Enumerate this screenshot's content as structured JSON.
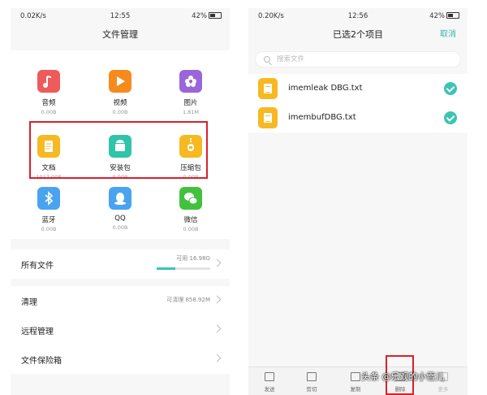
{
  "left": {
    "status": {
      "speed": "0.02K/s",
      "time": "12:55",
      "battery": "42%"
    },
    "title": "文件管理",
    "categories": [
      {
        "name": "音频",
        "size": "0.00B",
        "icon": "music-icon",
        "color": "#ef5a5a"
      },
      {
        "name": "视频",
        "size": "0.00B",
        "icon": "play-icon",
        "color": "#f78a1d"
      },
      {
        "name": "图片",
        "size": "1.81M",
        "icon": "flower-icon",
        "color": "#9a66d9"
      },
      {
        "name": "文档",
        "size": "1017.00B",
        "icon": "document-icon",
        "color": "#f6b922"
      },
      {
        "name": "安装包",
        "size": "0.00B",
        "icon": "android-icon",
        "color": "#2fc4a8"
      },
      {
        "name": "压缩包",
        "size": "0.00B",
        "icon": "zip-icon",
        "color": "#f6b922"
      },
      {
        "name": "蓝牙",
        "size": "0.00B",
        "icon": "bluetooth-icon",
        "color": "#4aa3ef"
      },
      {
        "name": "QQ",
        "size": "0.00B",
        "icon": "qq-icon",
        "color": "#4aa3ef"
      },
      {
        "name": "微信",
        "size": "0.00B",
        "icon": "wechat-icon",
        "color": "#42c13e"
      }
    ],
    "all_files": {
      "label": "所有文件",
      "available": "可用 16.98G",
      "used_fraction": 0.35
    },
    "rows": [
      {
        "label": "清理",
        "value": "可清理 858.92M"
      },
      {
        "label": "远程管理",
        "value": ""
      },
      {
        "label": "文件保险箱",
        "value": ""
      }
    ]
  },
  "right": {
    "status": {
      "speed": "0.20K/s",
      "time": "12:56",
      "battery": "42%"
    },
    "title": "已选2个项目",
    "cancel": "取消",
    "search_placeholder": "搜索文件",
    "files": [
      {
        "name": "imemleak DBG.txt"
      },
      {
        "name": "imembufDBG.txt"
      }
    ],
    "toolbar": [
      {
        "label": "发送",
        "icon": "share-icon"
      },
      {
        "label": "剪切",
        "icon": "cut-icon"
      },
      {
        "label": "复制",
        "icon": "copy-icon"
      },
      {
        "label": "删除",
        "icon": "delete-icon"
      },
      {
        "label": "更多",
        "icon": "more-icon"
      }
    ]
  },
  "watermark": "头条 @乐观的小雪儿",
  "accent": "#3cc4b4",
  "highlight": "#d9202c"
}
